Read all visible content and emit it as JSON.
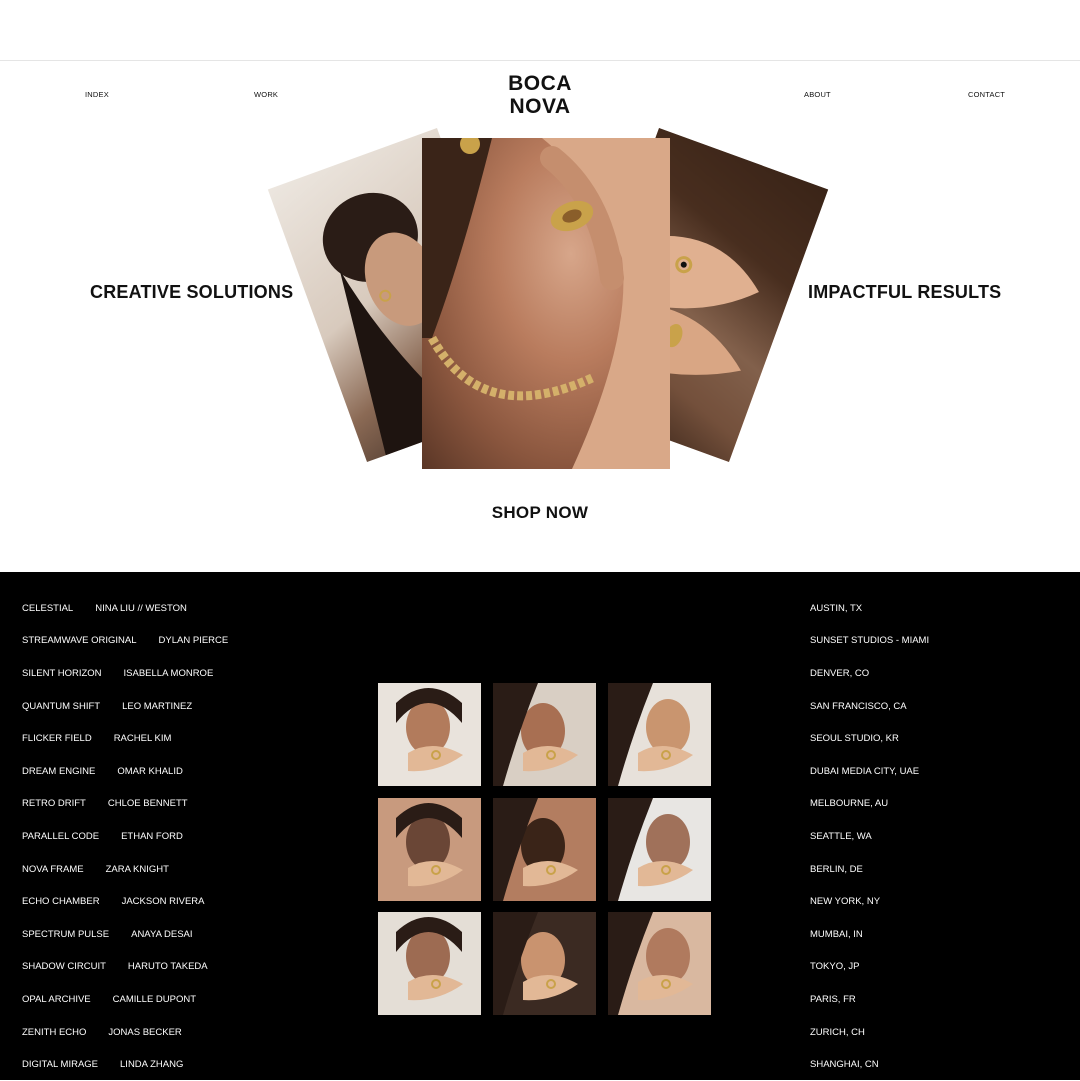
{
  "nav": {
    "links": [
      "INDEX",
      "WORK",
      "ABOUT",
      "CONTACT"
    ],
    "logo_line1": "BOCA",
    "logo_line2": "NOVA"
  },
  "hero": {
    "tagline_left": "CREATIVE SOLUTIONS",
    "tagline_right": "IMPACTFUL RESULTS",
    "cta": "SHOP NOW"
  },
  "footer": {
    "projects": [
      {
        "name": "CELESTIAL",
        "person": "NINA LIU // WESTON"
      },
      {
        "name": "STREAMWAVE ORIGINAL",
        "person": "DYLAN PIERCE"
      },
      {
        "name": "SILENT HORIZON",
        "person": "ISABELLA MONROE"
      },
      {
        "name": "QUANTUM SHIFT",
        "person": "LEO MARTINEZ"
      },
      {
        "name": "FLICKER FIELD",
        "person": "RACHEL KIM"
      },
      {
        "name": "DREAM ENGINE",
        "person": "OMAR KHALID"
      },
      {
        "name": "RETRO DRIFT",
        "person": "CHLOE BENNETT"
      },
      {
        "name": "PARALLEL CODE",
        "person": "ETHAN FORD"
      },
      {
        "name": "NOVA FRAME",
        "person": "ZARA KNIGHT"
      },
      {
        "name": "ECHO CHAMBER",
        "person": "JACKSON RIVERA"
      },
      {
        "name": "SPECTRUM PULSE",
        "person": "ANAYA DESAI"
      },
      {
        "name": "SHADOW CIRCUIT",
        "person": "HARUTO TAKEDA"
      },
      {
        "name": "OPAL ARCHIVE",
        "person": "CAMILLE DUPONT"
      },
      {
        "name": "ZENITH ECHO",
        "person": "JONAS BECKER"
      },
      {
        "name": "DIGITAL MIRAGE",
        "person": "LINDA ZHANG"
      }
    ],
    "locations": [
      "AUSTIN, TX",
      "SUNSET STUDIOS - MIAMI",
      "DENVER, CO",
      "SAN FRANCISCO, CA",
      "SEOUL STUDIO, KR",
      "DUBAI MEDIA CITY, UAE",
      "MELBOURNE, AU",
      "SEATTLE, WA",
      "BERLIN, DE",
      "NEW YORK, NY",
      "MUMBAI, IN",
      "TOKYO, JP",
      "PARIS, FR",
      "ZURICH, CH",
      "SHANGHAI, CN"
    ],
    "gallery": [
      {
        "icon": "photo-woman-white-blazer-icon",
        "bg": "#e9e3dc",
        "accent": "#b27b5c"
      },
      {
        "icon": "photo-smiling-woman-rings-icon",
        "bg": "#d9cfc4",
        "accent": "#a86f52"
      },
      {
        "icon": "photo-blonde-woman-rings-icon",
        "bg": "#e7e1da",
        "accent": "#c9956f"
      },
      {
        "icon": "photo-closeup-eyes-hands-icon",
        "bg": "#c89a7e",
        "accent": "#6a4636"
      },
      {
        "icon": "photo-hands-necklace-icon",
        "bg": "#b37d60",
        "accent": "#3a2418"
      },
      {
        "icon": "photo-hoop-earring-profile-icon",
        "bg": "#e8e6e3",
        "accent": "#a0715a"
      },
      {
        "icon": "photo-woman-hand-face-icon",
        "bg": "#e4ded6",
        "accent": "#9d6b52"
      },
      {
        "icon": "photo-hands-hair-rings-icon",
        "bg": "#3b2a22",
        "accent": "#c9936f"
      },
      {
        "icon": "photo-stacked-hands-rings-icon",
        "bg": "#d9b8a0",
        "accent": "#b07a5e"
      }
    ]
  },
  "colors": {
    "footer_bg": "#000000",
    "text_dark": "#111111",
    "gold": "#c9a24a"
  }
}
